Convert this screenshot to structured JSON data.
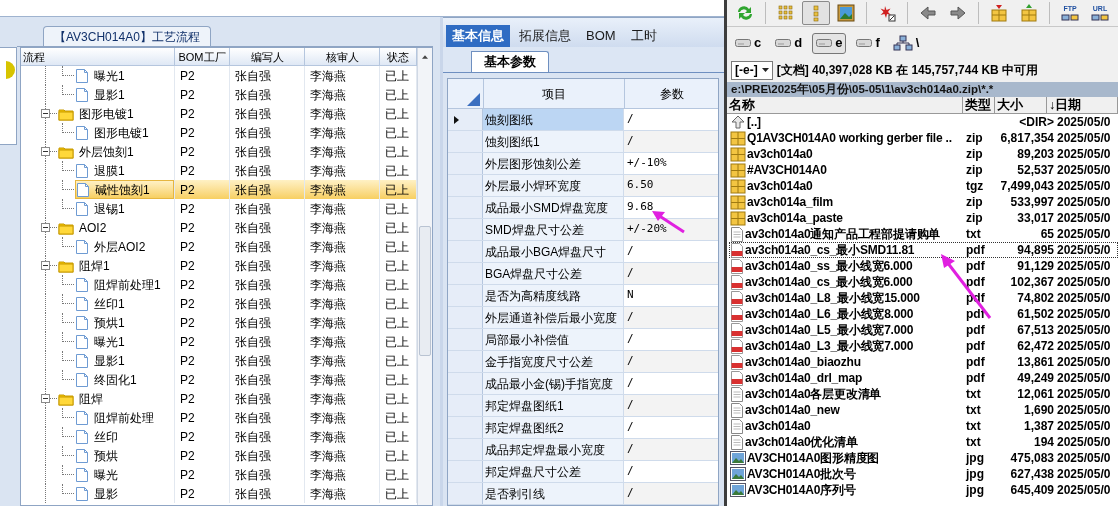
{
  "process_panel": {
    "tab": "【AV3CH014A0】工艺流程",
    "columns": [
      "流程",
      "BOM工厂",
      "编写人",
      "核审人",
      "状态"
    ],
    "rows": [
      {
        "kind": "step",
        "label": "曝光1",
        "bom": "P2",
        "writer": "张自强",
        "reviewer": "李海燕",
        "status": "已上",
        "selected": false
      },
      {
        "kind": "step",
        "label": "显影1",
        "bom": "P2",
        "writer": "张自强",
        "reviewer": "李海燕",
        "status": "已上",
        "selected": false
      },
      {
        "kind": "group",
        "label": "图形电镀1",
        "bom": "P2",
        "writer": "张自强",
        "reviewer": "李海燕",
        "status": "已上",
        "selected": false,
        "expanded": true,
        "children": [
          {
            "kind": "step",
            "label": "图形电镀1",
            "bom": "P2",
            "writer": "张自强",
            "reviewer": "李海燕",
            "status": "已上",
            "selected": false
          }
        ]
      },
      {
        "kind": "group",
        "label": "外层蚀刻1",
        "bom": "P2",
        "writer": "张自强",
        "reviewer": "李海燕",
        "status": "已上",
        "selected": false,
        "expanded": true,
        "children": [
          {
            "kind": "step",
            "label": "退膜1",
            "bom": "P2",
            "writer": "张自强",
            "reviewer": "李海燕",
            "status": "已上",
            "selected": false
          },
          {
            "kind": "step",
            "label": "碱性蚀刻1",
            "bom": "P2",
            "writer": "张自强",
            "reviewer": "李海燕",
            "status": "已上",
            "selected": true
          },
          {
            "kind": "step",
            "label": "退锡1",
            "bom": "P2",
            "writer": "张自强",
            "reviewer": "李海燕",
            "status": "已上",
            "selected": false
          }
        ]
      },
      {
        "kind": "group",
        "label": "AOI2",
        "bom": "P2",
        "writer": "张自强",
        "reviewer": "李海燕",
        "status": "已上",
        "selected": false,
        "expanded": true,
        "children": [
          {
            "kind": "step",
            "label": "外层AOI2",
            "bom": "P2",
            "writer": "张自强",
            "reviewer": "李海燕",
            "status": "已上",
            "selected": false
          }
        ]
      },
      {
        "kind": "group",
        "label": "阻焊1",
        "bom": "P2",
        "writer": "张自强",
        "reviewer": "李海燕",
        "status": "已上",
        "selected": false,
        "expanded": true,
        "children": [
          {
            "kind": "step",
            "label": "阻焊前处理1",
            "bom": "P2",
            "writer": "张自强",
            "reviewer": "李海燕",
            "status": "已上",
            "selected": false
          },
          {
            "kind": "step",
            "label": "丝印1",
            "bom": "P2",
            "writer": "张自强",
            "reviewer": "李海燕",
            "status": "已上",
            "selected": false
          },
          {
            "kind": "step",
            "label": "预烘1",
            "bom": "P2",
            "writer": "张自强",
            "reviewer": "李海燕",
            "status": "已上",
            "selected": false
          },
          {
            "kind": "step",
            "label": "曝光1",
            "bom": "P2",
            "writer": "张自强",
            "reviewer": "李海燕",
            "status": "已上",
            "selected": false
          },
          {
            "kind": "step",
            "label": "显影1",
            "bom": "P2",
            "writer": "张自强",
            "reviewer": "李海燕",
            "status": "已上",
            "selected": false
          },
          {
            "kind": "step",
            "label": "终固化1",
            "bom": "P2",
            "writer": "张自强",
            "reviewer": "李海燕",
            "status": "已上",
            "selected": false
          }
        ]
      },
      {
        "kind": "group",
        "label": "阻焊",
        "bom": "P2",
        "writer": "张自强",
        "reviewer": "李海燕",
        "status": "已上",
        "selected": false,
        "expanded": true,
        "children": [
          {
            "kind": "step",
            "label": "阻焊前处理",
            "bom": "P2",
            "writer": "张自强",
            "reviewer": "李海燕",
            "status": "已上",
            "selected": false
          },
          {
            "kind": "step",
            "label": "丝印",
            "bom": "P2",
            "writer": "张自强",
            "reviewer": "李海燕",
            "status": "已上",
            "selected": false
          },
          {
            "kind": "step",
            "label": "预烘",
            "bom": "P2",
            "writer": "张自强",
            "reviewer": "李海燕",
            "status": "已上",
            "selected": false
          },
          {
            "kind": "step",
            "label": "曝光",
            "bom": "P2",
            "writer": "张自强",
            "reviewer": "李海燕",
            "status": "已上",
            "selected": false
          },
          {
            "kind": "step",
            "label": "显影",
            "bom": "P2",
            "writer": "张自强",
            "reviewer": "李海燕",
            "status": "已上",
            "selected": false
          }
        ]
      }
    ]
  },
  "info_panel": {
    "tabs": [
      {
        "label": "基本信息",
        "selected": true
      },
      {
        "label": "拓展信息",
        "selected": false
      },
      {
        "label": "BOM",
        "selected": false
      },
      {
        "label": "工时",
        "selected": false
      }
    ],
    "sub_tab": "基本参数",
    "columns": [
      "项目",
      "参数"
    ],
    "rows": [
      {
        "item": "蚀刻图纸",
        "value": "/",
        "selected": true
      },
      {
        "item": "蚀刻图纸1",
        "value": "/",
        "selected": false
      },
      {
        "item": "外层图形蚀刻公差",
        "value": "+/-10%",
        "selected": false
      },
      {
        "item": "外层最小焊环宽度",
        "value": "6.50",
        "selected": false
      },
      {
        "item": "成品最小SMD焊盘宽度",
        "value": "9.68",
        "selected": false
      },
      {
        "item": "SMD焊盘尺寸公差",
        "value": "+/-20%",
        "selected": false
      },
      {
        "item": "成品最小BGA焊盘尺寸",
        "value": "/",
        "selected": false
      },
      {
        "item": "BGA焊盘尺寸公差",
        "value": "/",
        "selected": false
      },
      {
        "item": "是否为高精度线路",
        "value": "N",
        "selected": false
      },
      {
        "item": "外层通道补偿后最小宽度",
        "value": "/",
        "selected": false
      },
      {
        "item": "局部最小补偿值",
        "value": "/",
        "selected": false
      },
      {
        "item": "金手指宽度尺寸公差",
        "value": "/",
        "selected": false
      },
      {
        "item": "成品最小金(锡)手指宽度",
        "value": "/",
        "selected": false
      },
      {
        "item": "邦定焊盘图纸1",
        "value": "/",
        "selected": false
      },
      {
        "item": "邦定焊盘图纸2",
        "value": "/",
        "selected": false
      },
      {
        "item": "成品邦定焊盘最小宽度",
        "value": "/",
        "selected": false
      },
      {
        "item": "邦定焊盘尺寸公差",
        "value": "/",
        "selected": false
      },
      {
        "item": "是否剥引线",
        "value": "/",
        "selected": false
      }
    ]
  },
  "file_manager": {
    "toolbar": [
      {
        "selected": false
      },
      {
        "selected": false
      },
      {
        "selected": true
      },
      {
        "selected": false
      },
      {
        "selected": false
      },
      {
        "selected": false
      },
      {
        "selected": false
      },
      {
        "selected": false
      },
      {
        "selected": false
      },
      {
        "label": "FTP",
        "selected": false
      },
      {
        "label": "URL",
        "selected": false
      }
    ],
    "drives": [
      {
        "label": "c",
        "selected": false
      },
      {
        "label": "d",
        "selected": false
      },
      {
        "label": "e",
        "selected": true
      },
      {
        "label": "f",
        "selected": false
      }
    ],
    "root_label": "\\",
    "drive_select": "[-e-]",
    "free_space": "[文档] 40,397,028 KB 在 145,757,744 KB 中可用",
    "path": "e:\\PRE\\2025年\\05月份\\05-05\\1\\av3ch014a0.zip\\*.*",
    "columns": [
      "名称",
      "类型",
      "大小",
      "↓日期"
    ],
    "files": [
      {
        "kind": "up",
        "name": "[..]",
        "size": "<DIR>",
        "date": "2025/05/0",
        "selected": false
      },
      {
        "kind": "archive",
        "name": "Q1AV3CH014A0 working gerber file ..",
        "type": "zip",
        "size": "6,817,354",
        "date": "2025/05/0",
        "selected": false
      },
      {
        "kind": "archive",
        "name": "av3ch014a0",
        "type": "zip",
        "size": "89,203",
        "date": "2025/05/0",
        "selected": false
      },
      {
        "kind": "archive",
        "name": "#AV3CH014A0",
        "type": "zip",
        "size": "52,537",
        "date": "2025/05/0",
        "selected": false
      },
      {
        "kind": "archive",
        "name": "av3ch014a0",
        "type": "tgz",
        "size": "7,499,043",
        "date": "2025/05/0",
        "selected": false
      },
      {
        "kind": "archive",
        "name": "av3ch014a_film",
        "type": "zip",
        "size": "533,997",
        "date": "2025/05/0",
        "selected": false
      },
      {
        "kind": "archive",
        "name": "av3ch014a_paste",
        "type": "zip",
        "size": "33,017",
        "date": "2025/05/0",
        "selected": false
      },
      {
        "kind": "text",
        "name": "av3ch014a0通知产品工程部提请购单",
        "type": "txt",
        "size": "65",
        "date": "2025/05/0",
        "selected": false
      },
      {
        "kind": "pdf",
        "name": "av3ch014a0_cs_最小SMD11.81",
        "type": "pdf",
        "size": "94,895",
        "date": "2025/05/0",
        "selected": true
      },
      {
        "kind": "pdf",
        "name": "av3ch014a0_ss_最小线宽6.000",
        "type": "pdf",
        "size": "91,129",
        "date": "2025/05/0",
        "selected": false
      },
      {
        "kind": "pdf",
        "name": "av3ch014a0_cs_最小线宽6.000",
        "type": "pdf",
        "size": "102,367",
        "date": "2025/05/0",
        "selected": false
      },
      {
        "kind": "pdf",
        "name": "av3ch014a0_L8_最小线宽15.000",
        "type": "pdf",
        "size": "74,802",
        "date": "2025/05/0",
        "selected": false
      },
      {
        "kind": "pdf",
        "name": "av3ch014a0_L6_最小线宽8.000",
        "type": "pdf",
        "size": "61,502",
        "date": "2025/05/0",
        "selected": false
      },
      {
        "kind": "pdf",
        "name": "av3ch014a0_L5_最小线宽7.000",
        "type": "pdf",
        "size": "67,513",
        "date": "2025/05/0",
        "selected": false
      },
      {
        "kind": "pdf",
        "name": "av3ch014a0_L3_最小线宽7.000",
        "type": "pdf",
        "size": "62,472",
        "date": "2025/05/0",
        "selected": false
      },
      {
        "kind": "pdf",
        "name": "av3ch014a0_biaozhu",
        "type": "pdf",
        "size": "13,861",
        "date": "2025/05/0",
        "selected": false
      },
      {
        "kind": "pdf",
        "name": "av3ch014a0_drl_map",
        "type": "pdf",
        "size": "49,249",
        "date": "2025/05/0",
        "selected": false
      },
      {
        "kind": "text",
        "name": "av3ch014a0各层更改清单",
        "type": "txt",
        "size": "12,061",
        "date": "2025/05/0",
        "selected": false
      },
      {
        "kind": "text",
        "name": "av3ch014a0_new",
        "type": "txt",
        "size": "1,690",
        "date": "2025/05/0",
        "selected": false
      },
      {
        "kind": "text",
        "name": "av3ch014a0",
        "type": "txt",
        "size": "1,387",
        "date": "2025/05/0",
        "selected": false
      },
      {
        "kind": "text",
        "name": "av3ch014a0优化清单",
        "type": "txt",
        "size": "194",
        "date": "2025/05/0",
        "selected": false
      },
      {
        "kind": "image",
        "name": "AV3CH014A0图形精度图",
        "type": "jpg",
        "size": "475,083",
        "date": "2025/05/0",
        "selected": false
      },
      {
        "kind": "image",
        "name": "AV3CH014A0批次号",
        "type": "jpg",
        "size": "627,438",
        "date": "2025/05/0",
        "selected": false
      },
      {
        "kind": "image",
        "name": "AV3CH014A0序列号",
        "type": "jpg",
        "size": "645,409",
        "date": "2025/05/0",
        "selected": false
      }
    ]
  }
}
